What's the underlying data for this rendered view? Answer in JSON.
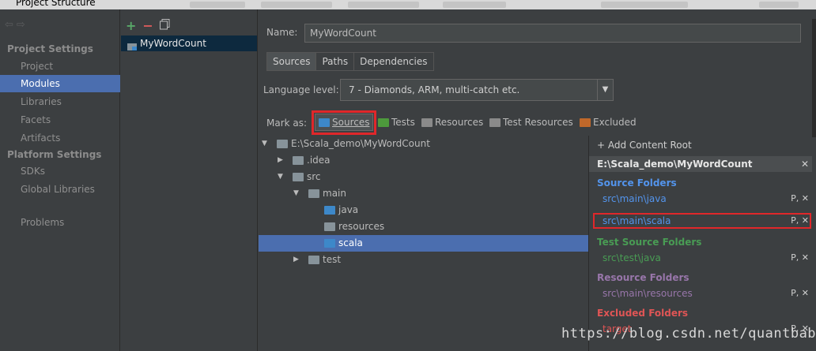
{
  "window": {
    "title": "Project Structure"
  },
  "nav": {
    "back_icon": "back-arrow-icon",
    "forward_icon": "forward-arrow-icon",
    "sections": [
      {
        "title": "Project Settings",
        "items": [
          "Project",
          "Modules",
          "Libraries",
          "Facets",
          "Artifacts"
        ]
      },
      {
        "title": "Platform Settings",
        "items": [
          "SDKs",
          "Global Libraries"
        ]
      }
    ],
    "extra": "Problems",
    "selected": "Modules"
  },
  "modules": {
    "toolbar": {
      "add": "+",
      "remove": "−",
      "copy_icon": "copy-icon"
    },
    "items": [
      "MyWordCount"
    ]
  },
  "editor": {
    "name_label": "Name:",
    "name_value": "MyWordCount",
    "tabs": [
      "Sources",
      "Paths",
      "Dependencies"
    ],
    "active_tab": "Sources",
    "language_label": "Language level:",
    "language_value": "7 - Diamonds, ARM, multi-catch etc.",
    "mark_as_label": "Mark as:",
    "mark_buttons": [
      {
        "label": "Sources",
        "color": "#3d88c9"
      },
      {
        "label": "Tests",
        "color": "#4d9a3c"
      },
      {
        "label": "Resources",
        "color": "#8a8a8a"
      },
      {
        "label": "Test Resources",
        "color": "#8a8a8a"
      },
      {
        "label": "Excluded",
        "color": "#c0682a"
      }
    ]
  },
  "tree": {
    "rows": [
      {
        "label": "E:\\Scala_demo\\MyWordCount",
        "arrow": "▼"
      },
      {
        "label": ".idea",
        "arrow": "▶"
      },
      {
        "label": "src",
        "arrow": "▼"
      },
      {
        "label": "main",
        "arrow": "▼"
      },
      {
        "label": "java",
        "arrow": ""
      },
      {
        "label": "resources",
        "arrow": ""
      },
      {
        "label": "scala",
        "arrow": ""
      },
      {
        "label": "test",
        "arrow": "▶"
      }
    ],
    "selected": "scala"
  },
  "roots": {
    "add_label": "+ Add Content Root",
    "root_path": "E:\\Scala_demo\\MyWordCount",
    "groups": [
      {
        "title": "Source Folders",
        "color": "#5394ec",
        "entries": [
          "src\\main\\java",
          "src\\main\\scala"
        ]
      },
      {
        "title": "Test Source Folders",
        "color": "#499c54",
        "entries": [
          "src\\test\\java"
        ]
      },
      {
        "title": "Resource Folders",
        "color": "#9876aa",
        "entries": [
          "src\\main\\resources"
        ]
      },
      {
        "title": "Excluded Folders",
        "color": "#e05555",
        "entries": [
          "target"
        ]
      }
    ],
    "entry_actions": "P, ✕"
  },
  "watermark": "https://blog.csdn.net/quantbaby"
}
